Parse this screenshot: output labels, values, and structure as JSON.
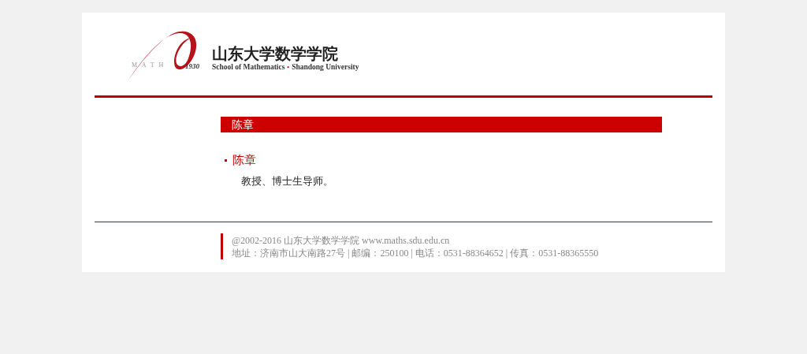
{
  "logo": {
    "mark_text": "M A T H",
    "year": "1930",
    "title": "山东大学数学学院",
    "subtitle": "School of Mathematics",
    "subtitle_sep": "•",
    "subtitle_2": "Shandong University"
  },
  "section_title": "陈章",
  "entries": [
    {
      "name": "陈章",
      "description": "教授、博士生导师。"
    }
  ],
  "footer": {
    "lines": [
      "@2002-2016 山东大学数学学院 www.maths.sdu.edu.cn",
      "地址：济南市山大南路27号 | 邮编：250100 | 电话：0531-88364652 | 传真：0531-88365550"
    ]
  }
}
